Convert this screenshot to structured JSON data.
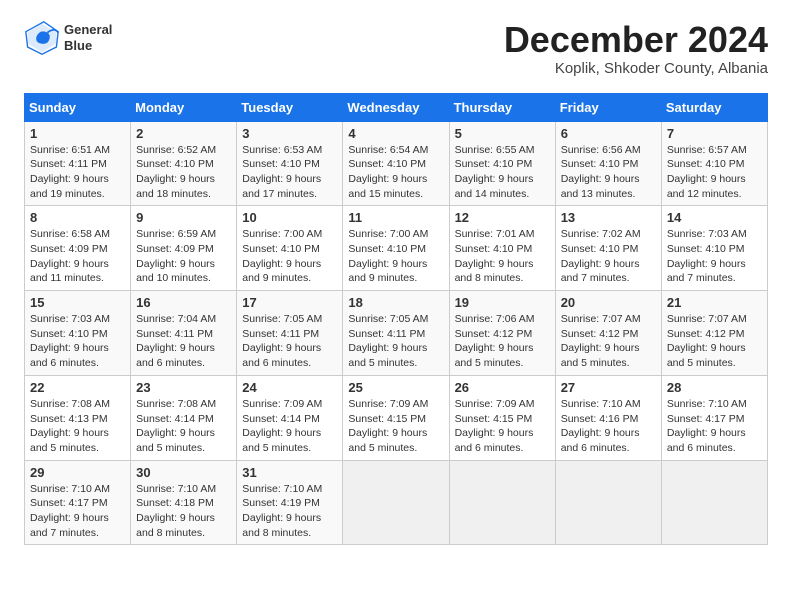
{
  "header": {
    "logo_line1": "General",
    "logo_line2": "Blue",
    "month": "December 2024",
    "location": "Koplik, Shkoder County, Albania"
  },
  "days_of_week": [
    "Sunday",
    "Monday",
    "Tuesday",
    "Wednesday",
    "Thursday",
    "Friday",
    "Saturday"
  ],
  "weeks": [
    [
      {
        "day": "1",
        "info": "Sunrise: 6:51 AM\nSunset: 4:11 PM\nDaylight: 9 hours and 19 minutes."
      },
      {
        "day": "2",
        "info": "Sunrise: 6:52 AM\nSunset: 4:10 PM\nDaylight: 9 hours and 18 minutes."
      },
      {
        "day": "3",
        "info": "Sunrise: 6:53 AM\nSunset: 4:10 PM\nDaylight: 9 hours and 17 minutes."
      },
      {
        "day": "4",
        "info": "Sunrise: 6:54 AM\nSunset: 4:10 PM\nDaylight: 9 hours and 15 minutes."
      },
      {
        "day": "5",
        "info": "Sunrise: 6:55 AM\nSunset: 4:10 PM\nDaylight: 9 hours and 14 minutes."
      },
      {
        "day": "6",
        "info": "Sunrise: 6:56 AM\nSunset: 4:10 PM\nDaylight: 9 hours and 13 minutes."
      },
      {
        "day": "7",
        "info": "Sunrise: 6:57 AM\nSunset: 4:10 PM\nDaylight: 9 hours and 12 minutes."
      }
    ],
    [
      {
        "day": "8",
        "info": "Sunrise: 6:58 AM\nSunset: 4:09 PM\nDaylight: 9 hours and 11 minutes."
      },
      {
        "day": "9",
        "info": "Sunrise: 6:59 AM\nSunset: 4:09 PM\nDaylight: 9 hours and 10 minutes."
      },
      {
        "day": "10",
        "info": "Sunrise: 7:00 AM\nSunset: 4:10 PM\nDaylight: 9 hours and 9 minutes."
      },
      {
        "day": "11",
        "info": "Sunrise: 7:00 AM\nSunset: 4:10 PM\nDaylight: 9 hours and 9 minutes."
      },
      {
        "day": "12",
        "info": "Sunrise: 7:01 AM\nSunset: 4:10 PM\nDaylight: 9 hours and 8 minutes."
      },
      {
        "day": "13",
        "info": "Sunrise: 7:02 AM\nSunset: 4:10 PM\nDaylight: 9 hours and 7 minutes."
      },
      {
        "day": "14",
        "info": "Sunrise: 7:03 AM\nSunset: 4:10 PM\nDaylight: 9 hours and 7 minutes."
      }
    ],
    [
      {
        "day": "15",
        "info": "Sunrise: 7:03 AM\nSunset: 4:10 PM\nDaylight: 9 hours and 6 minutes."
      },
      {
        "day": "16",
        "info": "Sunrise: 7:04 AM\nSunset: 4:11 PM\nDaylight: 9 hours and 6 minutes."
      },
      {
        "day": "17",
        "info": "Sunrise: 7:05 AM\nSunset: 4:11 PM\nDaylight: 9 hours and 6 minutes."
      },
      {
        "day": "18",
        "info": "Sunrise: 7:05 AM\nSunset: 4:11 PM\nDaylight: 9 hours and 5 minutes."
      },
      {
        "day": "19",
        "info": "Sunrise: 7:06 AM\nSunset: 4:12 PM\nDaylight: 9 hours and 5 minutes."
      },
      {
        "day": "20",
        "info": "Sunrise: 7:07 AM\nSunset: 4:12 PM\nDaylight: 9 hours and 5 minutes."
      },
      {
        "day": "21",
        "info": "Sunrise: 7:07 AM\nSunset: 4:12 PM\nDaylight: 9 hours and 5 minutes."
      }
    ],
    [
      {
        "day": "22",
        "info": "Sunrise: 7:08 AM\nSunset: 4:13 PM\nDaylight: 9 hours and 5 minutes."
      },
      {
        "day": "23",
        "info": "Sunrise: 7:08 AM\nSunset: 4:14 PM\nDaylight: 9 hours and 5 minutes."
      },
      {
        "day": "24",
        "info": "Sunrise: 7:09 AM\nSunset: 4:14 PM\nDaylight: 9 hours and 5 minutes."
      },
      {
        "day": "25",
        "info": "Sunrise: 7:09 AM\nSunset: 4:15 PM\nDaylight: 9 hours and 5 minutes."
      },
      {
        "day": "26",
        "info": "Sunrise: 7:09 AM\nSunset: 4:15 PM\nDaylight: 9 hours and 6 minutes."
      },
      {
        "day": "27",
        "info": "Sunrise: 7:10 AM\nSunset: 4:16 PM\nDaylight: 9 hours and 6 minutes."
      },
      {
        "day": "28",
        "info": "Sunrise: 7:10 AM\nSunset: 4:17 PM\nDaylight: 9 hours and 6 minutes."
      }
    ],
    [
      {
        "day": "29",
        "info": "Sunrise: 7:10 AM\nSunset: 4:17 PM\nDaylight: 9 hours and 7 minutes."
      },
      {
        "day": "30",
        "info": "Sunrise: 7:10 AM\nSunset: 4:18 PM\nDaylight: 9 hours and 8 minutes."
      },
      {
        "day": "31",
        "info": "Sunrise: 7:10 AM\nSunset: 4:19 PM\nDaylight: 9 hours and 8 minutes."
      },
      null,
      null,
      null,
      null
    ]
  ]
}
